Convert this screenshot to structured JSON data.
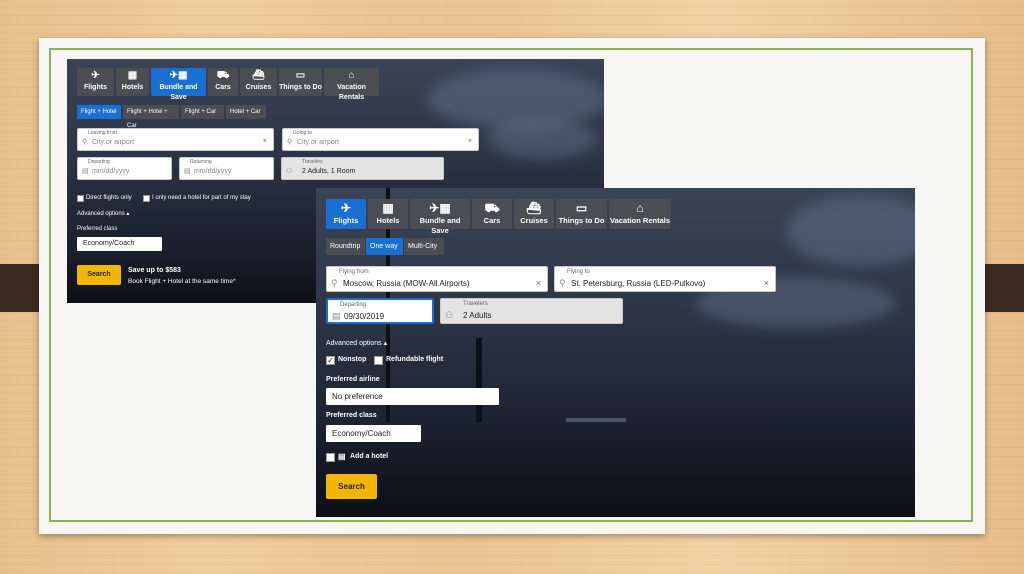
{
  "screen1": {
    "nav": [
      {
        "label": "Flights",
        "icon": "airplane-icon",
        "glyph": "✈",
        "active": false
      },
      {
        "label": "Hotels",
        "icon": "hotel-icon",
        "glyph": "▦",
        "active": false
      },
      {
        "label": "Bundle and Save",
        "icon": "bundle-icon",
        "glyph": "✈▦",
        "active": true
      },
      {
        "label": "Cars",
        "icon": "car-icon",
        "glyph": "⛟",
        "active": false
      },
      {
        "label": "Cruises",
        "icon": "cruise-icon",
        "glyph": "⛴",
        "active": false
      },
      {
        "label": "Things to Do",
        "icon": "ticket-icon",
        "glyph": "▭",
        "active": false
      },
      {
        "label": "Vacation Rentals",
        "icon": "house-icon",
        "glyph": "⌂",
        "active": false
      }
    ],
    "subtabs": [
      {
        "label": "Flight + Hotel",
        "active": true
      },
      {
        "label": "Flight + Hotel + Car",
        "active": false
      },
      {
        "label": "Flight + Car",
        "active": false
      },
      {
        "label": "Hotel + Car",
        "active": false
      }
    ],
    "leaving_label": "Leaving from",
    "leaving_placeholder": "City or airport",
    "going_label": "Going to",
    "going_placeholder": "City or airport",
    "departing_label": "Departing",
    "departing_placeholder": "mm/dd/yyyy",
    "returning_label": "Returning",
    "returning_placeholder": "mm/dd/yyyy",
    "travelers_label": "Travelers",
    "travelers_value": "2 Adults, 1 Room",
    "direct_flights": "Direct flights only",
    "partial_hotel": "I only need a hotel for part of my stay",
    "advanced": "Advanced options ▴",
    "preferred_class_label": "Preferred class",
    "preferred_class_value": "Economy/Coach",
    "search": "Search",
    "promo_title": "Save up to $583",
    "promo_sub": "Book Flight + Hotel at the same time*"
  },
  "screen2": {
    "nav": [
      {
        "label": "Flights",
        "icon": "airplane-icon",
        "glyph": "✈",
        "active": true
      },
      {
        "label": "Hotels",
        "icon": "hotel-icon",
        "glyph": "▦",
        "active": false
      },
      {
        "label": "Bundle and Save",
        "icon": "bundle-icon",
        "glyph": "✈▦",
        "active": false
      },
      {
        "label": "Cars",
        "icon": "car-icon",
        "glyph": "⛟",
        "active": false
      },
      {
        "label": "Cruises",
        "icon": "cruise-icon",
        "glyph": "⛴",
        "active": false
      },
      {
        "label": "Things to Do",
        "icon": "ticket-icon",
        "glyph": "▭",
        "active": false
      },
      {
        "label": "Vacation Rentals",
        "icon": "house-icon",
        "glyph": "⌂",
        "active": false
      }
    ],
    "subtabs": [
      {
        "label": "Roundtrip",
        "active": false
      },
      {
        "label": "One way",
        "active": true
      },
      {
        "label": "Multi-City",
        "active": false
      }
    ],
    "flying_from_label": "Flying from",
    "flying_from_value": "Moscow, Russia (MOW-All Airports)",
    "flying_to_label": "Flying to",
    "flying_to_value": "St. Petersburg, Russia (LED-Pulkovo)",
    "departing_label": "Departing",
    "departing_value": "09/30/2019",
    "travelers_label": "Travelers",
    "travelers_value": "2 Adults",
    "advanced": "Advanced options ▴",
    "nonstop": "Nonstop",
    "nonstop_checked": true,
    "refundable": "Refundable flight",
    "preferred_airline_label": "Preferred airline",
    "preferred_airline_value": "No preference",
    "preferred_class_label": "Preferred class",
    "preferred_class_value": "Economy/Coach",
    "add_hotel": "Add a hotel",
    "search": "Search"
  },
  "colors": {
    "accent": "#1a6fd0",
    "search": "#f2b600",
    "frame": "#8ab251"
  }
}
